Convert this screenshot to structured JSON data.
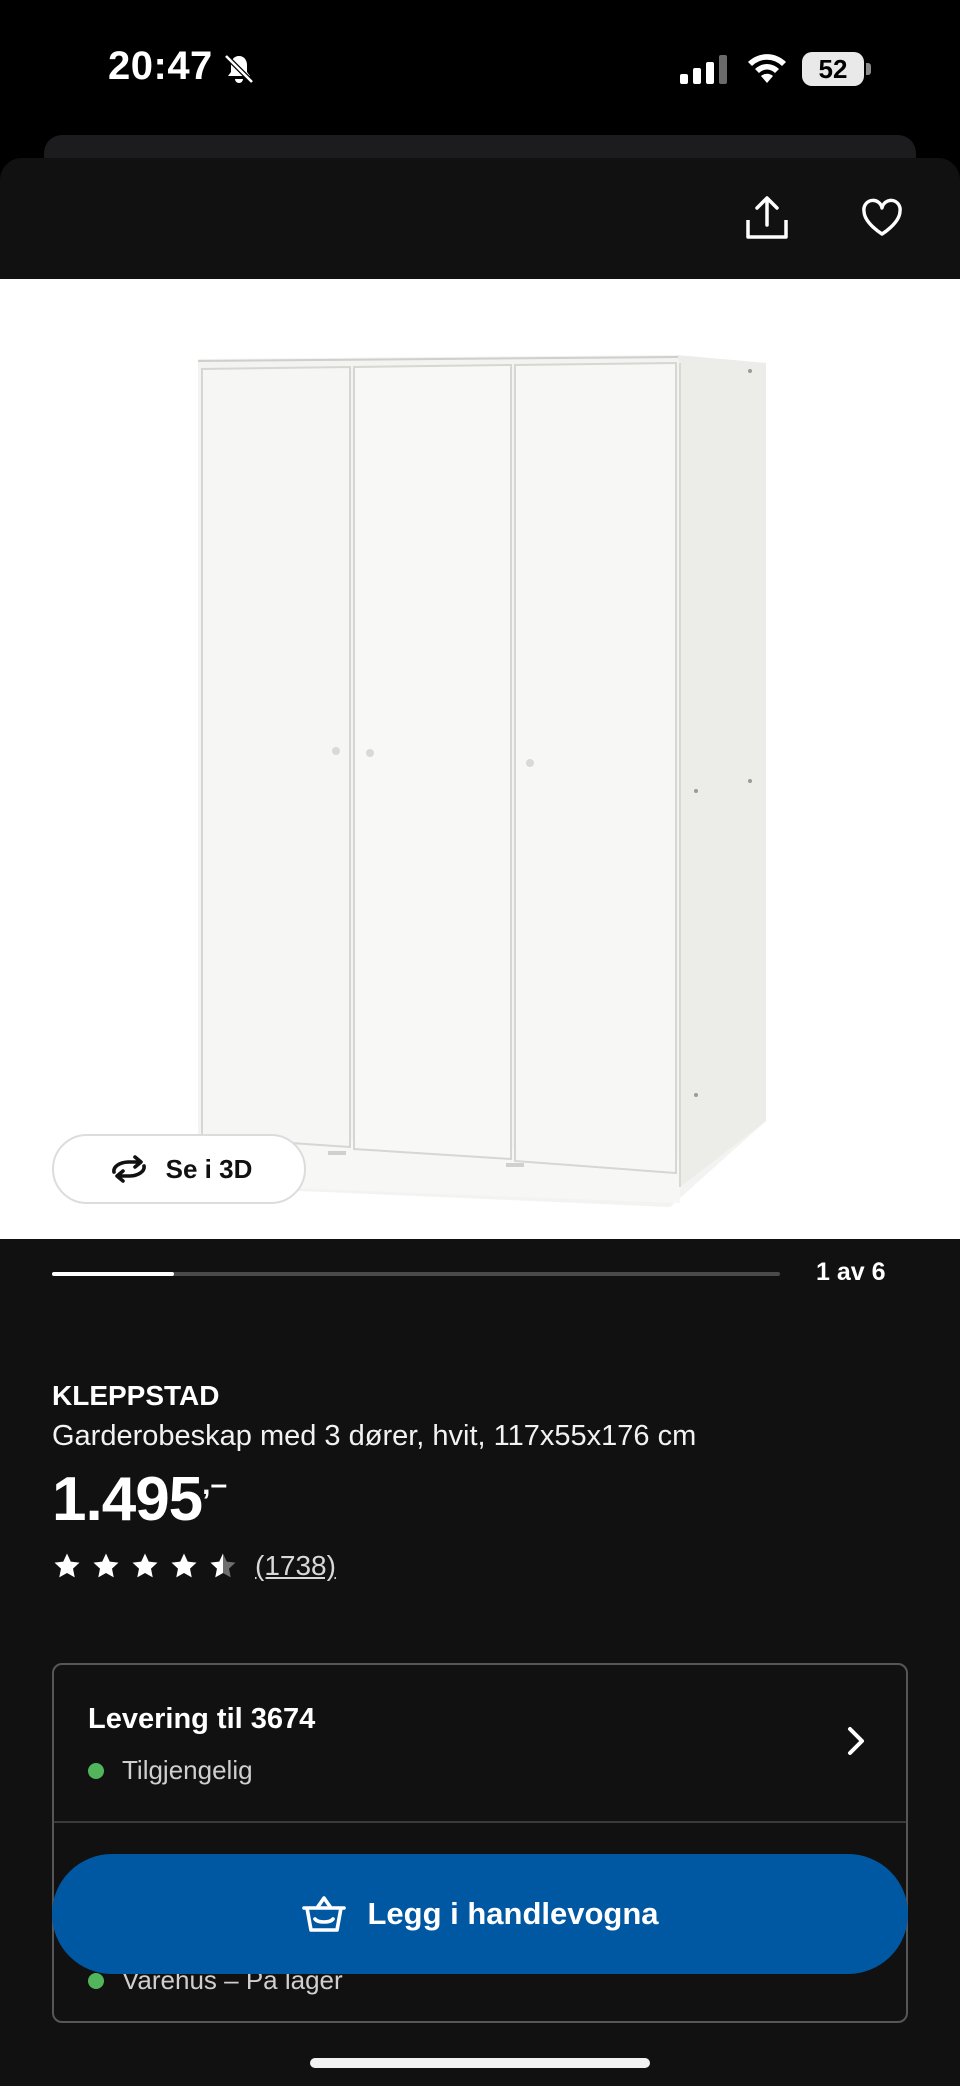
{
  "status_bar": {
    "time": "20:47",
    "battery": "52"
  },
  "gallery": {
    "current": 1,
    "total": 6,
    "counter_label": "1 av 6",
    "progress": 0.167,
    "see_3d_label": "Se i 3D"
  },
  "product": {
    "name": "KLEPPSTAD",
    "description": "Garderobeskap med 3 dører, hvit, 117x55x176 cm",
    "price": "1.495",
    "price_suffix": ",–",
    "rating": 4.5,
    "review_count_label": "(1738)"
  },
  "delivery": {
    "title": "Levering til 3674",
    "status": "Tilgjengelig",
    "store_status": "Varehus – På lager"
  },
  "cart_button_label": "Legg i handlevogna",
  "colors": {
    "accent": "#0058a3",
    "available": "#52b55b"
  }
}
